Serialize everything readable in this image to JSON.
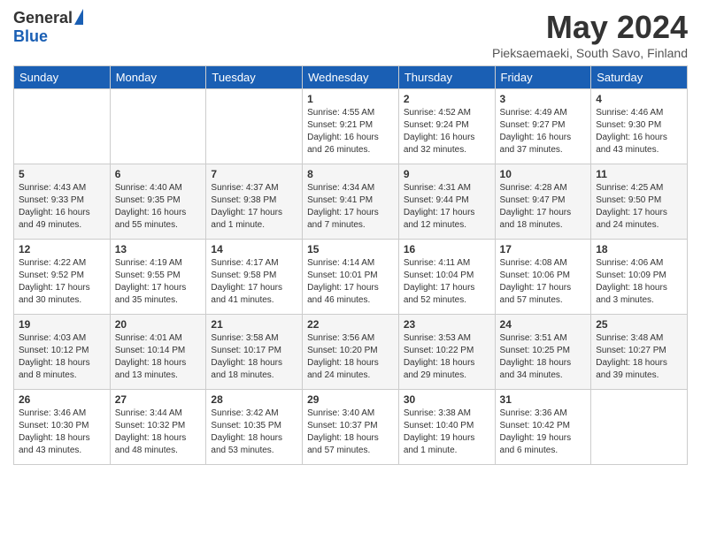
{
  "logo": {
    "general": "General",
    "blue": "Blue"
  },
  "title": "May 2024",
  "subtitle": "Pieksaemaeki, South Savo, Finland",
  "headers": [
    "Sunday",
    "Monday",
    "Tuesday",
    "Wednesday",
    "Thursday",
    "Friday",
    "Saturday"
  ],
  "weeks": [
    [
      {
        "day": "",
        "info": ""
      },
      {
        "day": "",
        "info": ""
      },
      {
        "day": "",
        "info": ""
      },
      {
        "day": "1",
        "info": "Sunrise: 4:55 AM\nSunset: 9:21 PM\nDaylight: 16 hours\nand 26 minutes."
      },
      {
        "day": "2",
        "info": "Sunrise: 4:52 AM\nSunset: 9:24 PM\nDaylight: 16 hours\nand 32 minutes."
      },
      {
        "day": "3",
        "info": "Sunrise: 4:49 AM\nSunset: 9:27 PM\nDaylight: 16 hours\nand 37 minutes."
      },
      {
        "day": "4",
        "info": "Sunrise: 4:46 AM\nSunset: 9:30 PM\nDaylight: 16 hours\nand 43 minutes."
      }
    ],
    [
      {
        "day": "5",
        "info": "Sunrise: 4:43 AM\nSunset: 9:33 PM\nDaylight: 16 hours\nand 49 minutes."
      },
      {
        "day": "6",
        "info": "Sunrise: 4:40 AM\nSunset: 9:35 PM\nDaylight: 16 hours\nand 55 minutes."
      },
      {
        "day": "7",
        "info": "Sunrise: 4:37 AM\nSunset: 9:38 PM\nDaylight: 17 hours\nand 1 minute."
      },
      {
        "day": "8",
        "info": "Sunrise: 4:34 AM\nSunset: 9:41 PM\nDaylight: 17 hours\nand 7 minutes."
      },
      {
        "day": "9",
        "info": "Sunrise: 4:31 AM\nSunset: 9:44 PM\nDaylight: 17 hours\nand 12 minutes."
      },
      {
        "day": "10",
        "info": "Sunrise: 4:28 AM\nSunset: 9:47 PM\nDaylight: 17 hours\nand 18 minutes."
      },
      {
        "day": "11",
        "info": "Sunrise: 4:25 AM\nSunset: 9:50 PM\nDaylight: 17 hours\nand 24 minutes."
      }
    ],
    [
      {
        "day": "12",
        "info": "Sunrise: 4:22 AM\nSunset: 9:52 PM\nDaylight: 17 hours\nand 30 minutes."
      },
      {
        "day": "13",
        "info": "Sunrise: 4:19 AM\nSunset: 9:55 PM\nDaylight: 17 hours\nand 35 minutes."
      },
      {
        "day": "14",
        "info": "Sunrise: 4:17 AM\nSunset: 9:58 PM\nDaylight: 17 hours\nand 41 minutes."
      },
      {
        "day": "15",
        "info": "Sunrise: 4:14 AM\nSunset: 10:01 PM\nDaylight: 17 hours\nand 46 minutes."
      },
      {
        "day": "16",
        "info": "Sunrise: 4:11 AM\nSunset: 10:04 PM\nDaylight: 17 hours\nand 52 minutes."
      },
      {
        "day": "17",
        "info": "Sunrise: 4:08 AM\nSunset: 10:06 PM\nDaylight: 17 hours\nand 57 minutes."
      },
      {
        "day": "18",
        "info": "Sunrise: 4:06 AM\nSunset: 10:09 PM\nDaylight: 18 hours\nand 3 minutes."
      }
    ],
    [
      {
        "day": "19",
        "info": "Sunrise: 4:03 AM\nSunset: 10:12 PM\nDaylight: 18 hours\nand 8 minutes."
      },
      {
        "day": "20",
        "info": "Sunrise: 4:01 AM\nSunset: 10:14 PM\nDaylight: 18 hours\nand 13 minutes."
      },
      {
        "day": "21",
        "info": "Sunrise: 3:58 AM\nSunset: 10:17 PM\nDaylight: 18 hours\nand 18 minutes."
      },
      {
        "day": "22",
        "info": "Sunrise: 3:56 AM\nSunset: 10:20 PM\nDaylight: 18 hours\nand 24 minutes."
      },
      {
        "day": "23",
        "info": "Sunrise: 3:53 AM\nSunset: 10:22 PM\nDaylight: 18 hours\nand 29 minutes."
      },
      {
        "day": "24",
        "info": "Sunrise: 3:51 AM\nSunset: 10:25 PM\nDaylight: 18 hours\nand 34 minutes."
      },
      {
        "day": "25",
        "info": "Sunrise: 3:48 AM\nSunset: 10:27 PM\nDaylight: 18 hours\nand 39 minutes."
      }
    ],
    [
      {
        "day": "26",
        "info": "Sunrise: 3:46 AM\nSunset: 10:30 PM\nDaylight: 18 hours\nand 43 minutes."
      },
      {
        "day": "27",
        "info": "Sunrise: 3:44 AM\nSunset: 10:32 PM\nDaylight: 18 hours\nand 48 minutes."
      },
      {
        "day": "28",
        "info": "Sunrise: 3:42 AM\nSunset: 10:35 PM\nDaylight: 18 hours\nand 53 minutes."
      },
      {
        "day": "29",
        "info": "Sunrise: 3:40 AM\nSunset: 10:37 PM\nDaylight: 18 hours\nand 57 minutes."
      },
      {
        "day": "30",
        "info": "Sunrise: 3:38 AM\nSunset: 10:40 PM\nDaylight: 19 hours\nand 1 minute."
      },
      {
        "day": "31",
        "info": "Sunrise: 3:36 AM\nSunset: 10:42 PM\nDaylight: 19 hours\nand 6 minutes."
      },
      {
        "day": "",
        "info": ""
      }
    ]
  ]
}
